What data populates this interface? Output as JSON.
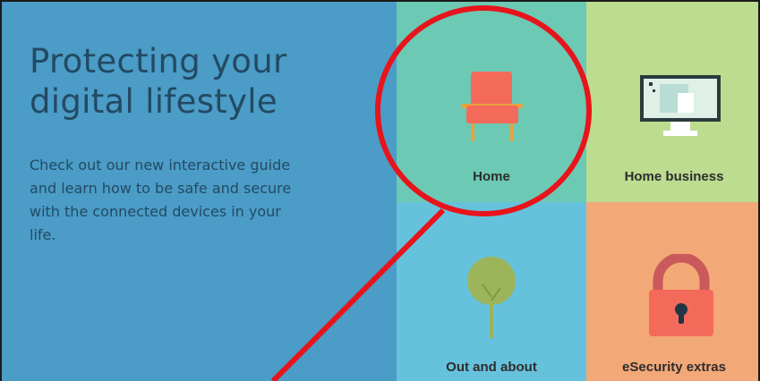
{
  "hero": {
    "title": "Protecting your digital lifestyle",
    "description": "Check out our new interactive guide and learn how to be safe and secure with the connected devices in your life."
  },
  "tiles": [
    {
      "label": "Home",
      "icon": "armchair-icon",
      "color": "#6cc9b4"
    },
    {
      "label": "Home business",
      "icon": "computer-monitor-icon",
      "color": "#bcdc90"
    },
    {
      "label": "Out and about",
      "icon": "tree-icon",
      "color": "#66c2dc"
    },
    {
      "label": "eSecurity extras",
      "icon": "padlock-icon",
      "color": "#f3a877"
    }
  ],
  "colors": {
    "hero_background": "#4b9cc7",
    "hero_text": "#234a63",
    "annotation": "#e8141c"
  }
}
